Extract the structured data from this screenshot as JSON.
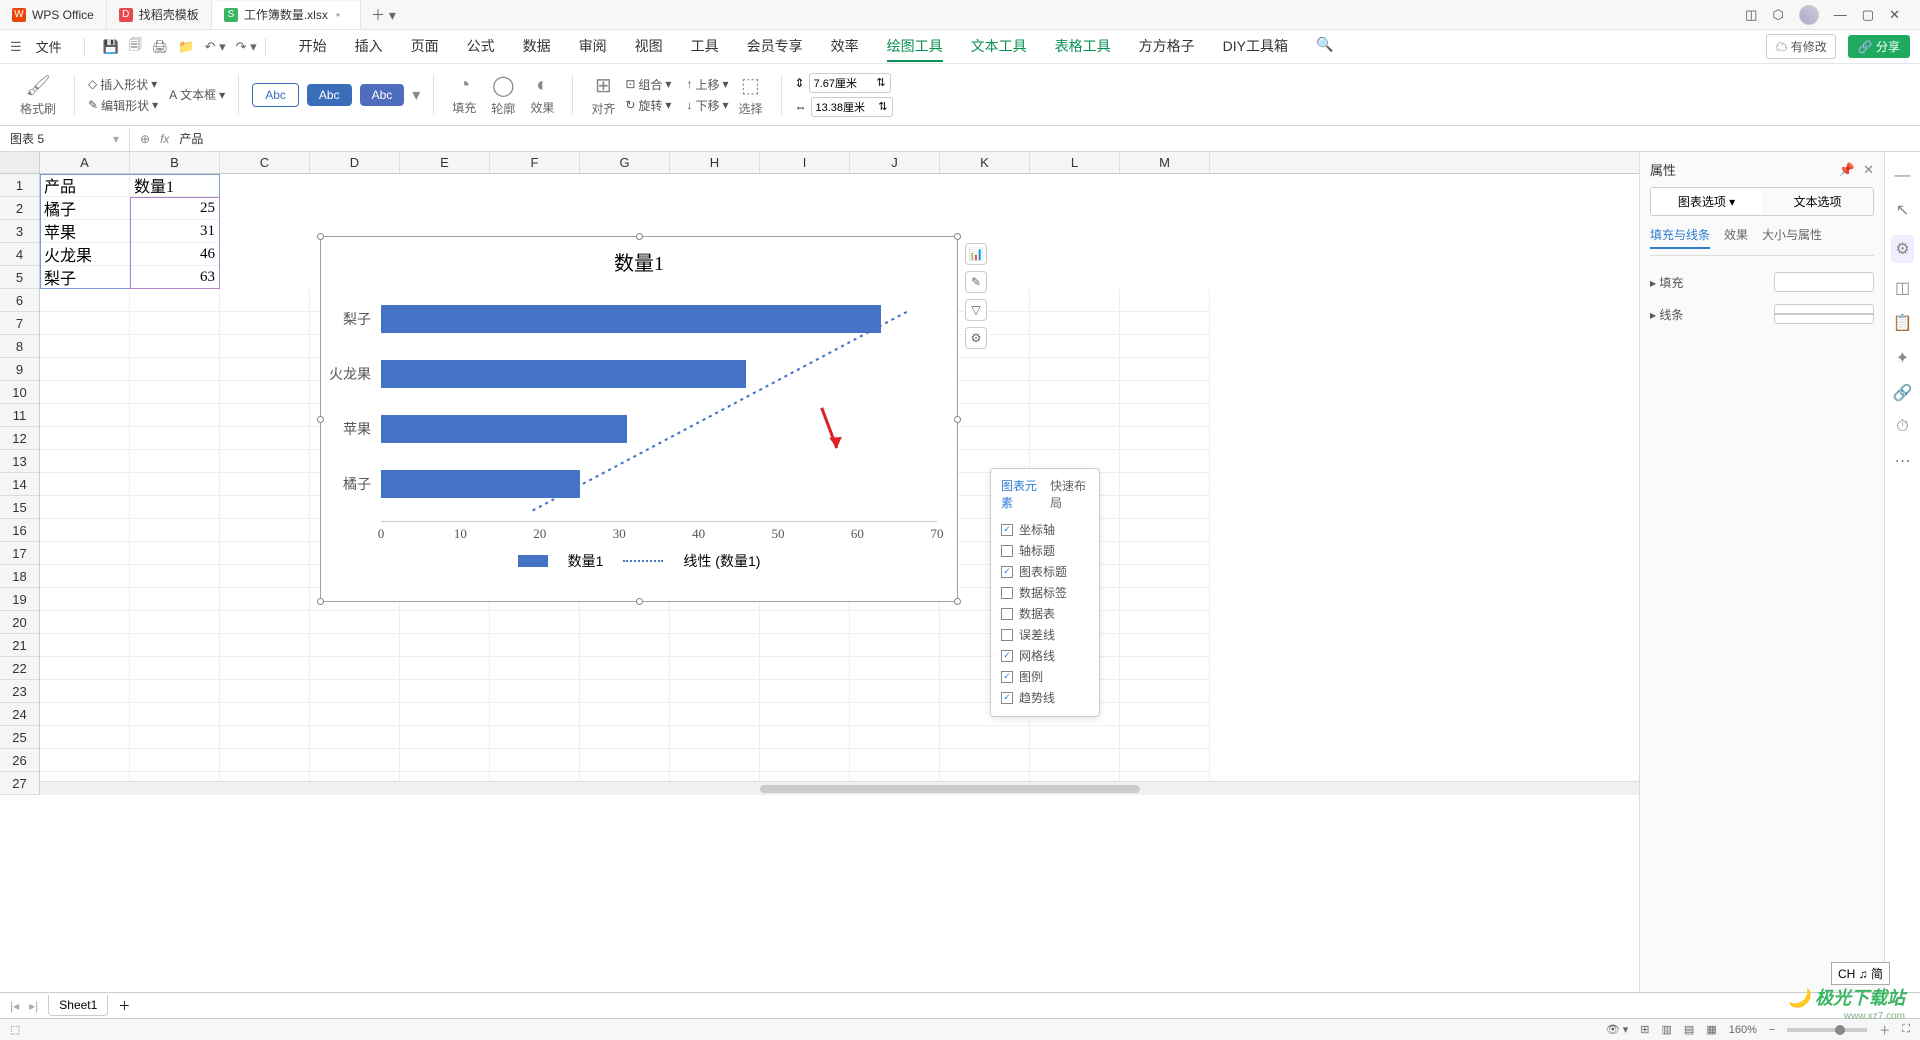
{
  "titlebar": {
    "tabs": [
      {
        "icon": "W",
        "label": "WPS Office"
      },
      {
        "icon": "D",
        "label": "找稻壳模板"
      },
      {
        "icon": "S",
        "label": "工作簿数量.xlsx",
        "dirty": "•"
      }
    ]
  },
  "menubar": {
    "file": "文件",
    "tabs": [
      "开始",
      "插入",
      "页面",
      "公式",
      "数据",
      "审阅",
      "视图",
      "工具",
      "会员专享",
      "效率",
      "绘图工具",
      "文本工具",
      "表格工具",
      "方方格子",
      "DIY工具箱"
    ],
    "active_tab": "绘图工具",
    "modify": "有修改",
    "share": "分享"
  },
  "ribbon": {
    "format_painter": "格式刷",
    "insert_shape": "插入形状",
    "text_box": "文本框",
    "edit_shape": "编辑形状",
    "abc": "Abc",
    "fill": "填充",
    "outline": "轮廓",
    "effect": "效果",
    "align": "对齐",
    "group": "组合",
    "rotate": "旋转",
    "up": "上移",
    "down": "下移",
    "select": "选择",
    "width": "7.67厘米",
    "height": "13.38厘米"
  },
  "namebox": {
    "name": "图表 5",
    "formula": "产品"
  },
  "columns": [
    "A",
    "B",
    "C",
    "D",
    "E",
    "F",
    "G",
    "H",
    "I",
    "J",
    "K",
    "L",
    "M"
  ],
  "rows_shown": 27,
  "table_header": {
    "a": "产品",
    "b": "数量1"
  },
  "table_rows": [
    {
      "a": "橘子",
      "b": "25"
    },
    {
      "a": "苹果",
      "b": "31"
    },
    {
      "a": "火龙果",
      "b": "46"
    },
    {
      "a": "梨子",
      "b": "63"
    }
  ],
  "chart_data": {
    "type": "bar",
    "title": "数量1",
    "orientation": "horizontal",
    "categories": [
      "梨子",
      "火龙果",
      "苹果",
      "橘子"
    ],
    "values": [
      63,
      46,
      31,
      25
    ],
    "xlim": [
      0,
      70
    ],
    "x_ticks": [
      0,
      10,
      20,
      30,
      40,
      50,
      60,
      70
    ],
    "legend": [
      "数量1",
      "线性 (数量1)"
    ],
    "trendline": "linear"
  },
  "chart_elements_popup": {
    "tabs": [
      "图表元素",
      "快速布局"
    ],
    "items": [
      {
        "label": "坐标轴",
        "checked": true
      },
      {
        "label": "轴标题",
        "checked": false
      },
      {
        "label": "图表标题",
        "checked": true
      },
      {
        "label": "数据标签",
        "checked": false
      },
      {
        "label": "数据表",
        "checked": false
      },
      {
        "label": "误差线",
        "checked": false
      },
      {
        "label": "网格线",
        "checked": true
      },
      {
        "label": "图例",
        "checked": true
      },
      {
        "label": "趋势线",
        "checked": true
      }
    ]
  },
  "props_panel": {
    "title": "属性",
    "tabs": [
      "图表选项",
      "文本选项"
    ],
    "subtabs": [
      "填充与线条",
      "效果",
      "大小与属性"
    ],
    "fill": "填充",
    "line": "线条"
  },
  "sheet_tabs": {
    "active": "Sheet1"
  },
  "statusbar": {
    "zoom": "160%"
  },
  "ime": "CH ♫ 简",
  "watermark": "极光下载站",
  "watermark_url": "www.xz7.com"
}
